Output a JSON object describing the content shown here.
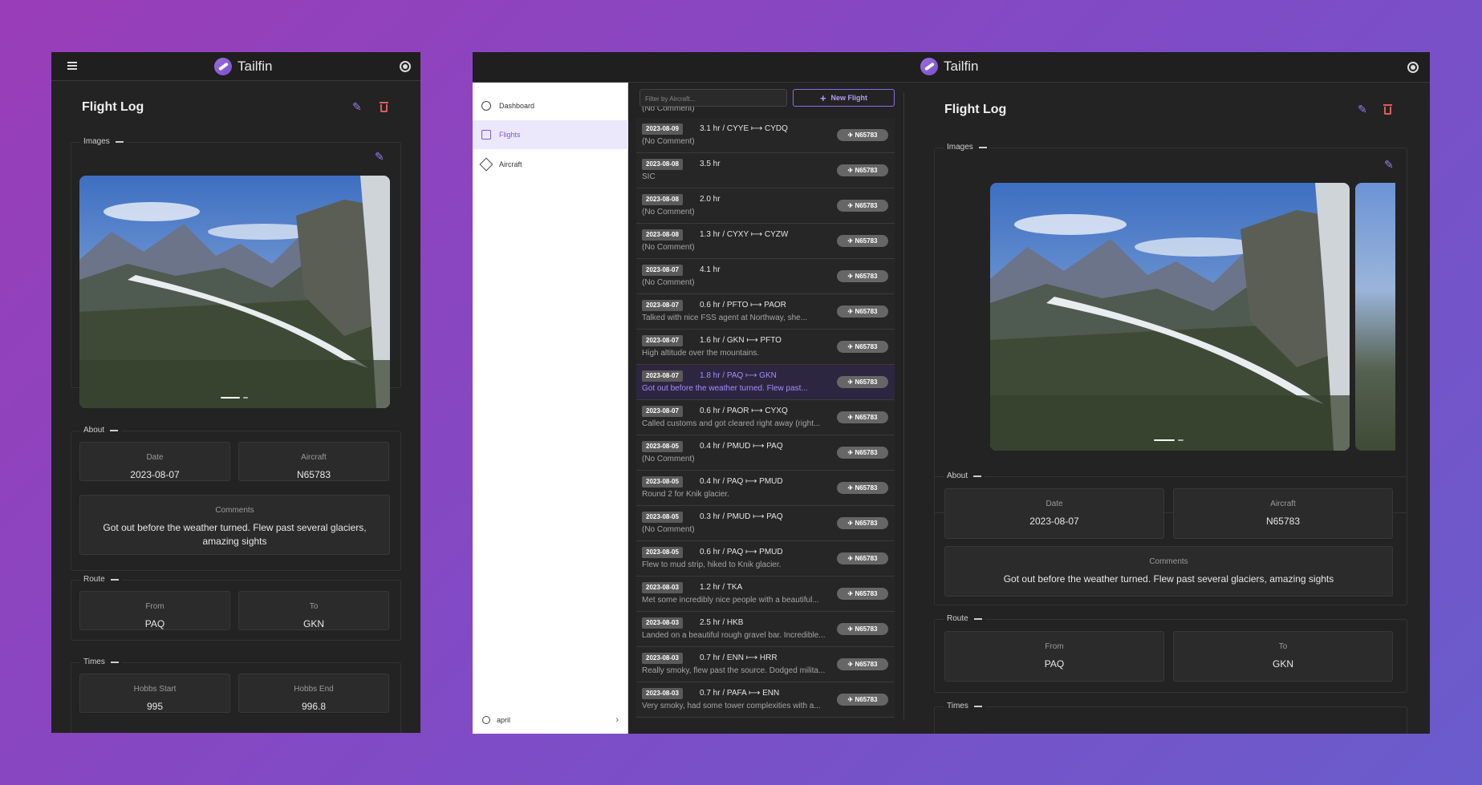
{
  "app": {
    "name": "Tailfin"
  },
  "mobile": {
    "page_title": "Flight Log",
    "sections": {
      "images": "Images",
      "about": "About",
      "route": "Route",
      "times": "Times"
    },
    "about": {
      "date_label": "Date",
      "date": "2023-08-07",
      "aircraft_label": "Aircraft",
      "aircraft": "N65783",
      "comments_label": "Comments",
      "comments": "Got out before the weather turned. Flew past several glaciers, amazing sights"
    },
    "route": {
      "from_label": "From",
      "from": "PAQ",
      "to_label": "To",
      "to": "GKN"
    },
    "times": {
      "hobbs_start_label": "Hobbs Start",
      "hobbs_start": "995",
      "hobbs_end_label": "Hobbs End",
      "hobbs_end": "996.8"
    }
  },
  "desktop": {
    "sidebar": {
      "items": [
        {
          "label": "Dashboard"
        },
        {
          "label": "Flights"
        },
        {
          "label": "Aircraft"
        }
      ],
      "user": "april"
    },
    "filter_placeholder": "Filter by Aircraft...",
    "new_flight_label": "New Flight",
    "partial_top_comment": "(No Comment)",
    "flights": [
      {
        "date": "2023-08-09",
        "info": "3.1 hr  /  CYYE ⟼ CYDQ",
        "comment": "(No Comment)",
        "tail": "N65783"
      },
      {
        "date": "2023-08-08",
        "info": "3.5 hr",
        "comment": "SIC",
        "tail": "N65783"
      },
      {
        "date": "2023-08-08",
        "info": "2.0 hr",
        "comment": "(No Comment)",
        "tail": "N65783"
      },
      {
        "date": "2023-08-08",
        "info": "1.3 hr  /  CYXY ⟼ CYZW",
        "comment": "(No Comment)",
        "tail": "N65783"
      },
      {
        "date": "2023-08-07",
        "info": "4.1 hr",
        "comment": "(No Comment)",
        "tail": "N65783"
      },
      {
        "date": "2023-08-07",
        "info": "0.6 hr  /  PFTO ⟼ PAOR",
        "comment": "Talked with nice FSS agent at Northway, she...",
        "tail": "N65783"
      },
      {
        "date": "2023-08-07",
        "info": "1.6 hr  /  GKN ⟼ PFTO",
        "comment": "High altitude over the mountains.",
        "tail": "N65783"
      },
      {
        "date": "2023-08-07",
        "info": "1.8 hr  /  PAQ ⟼ GKN",
        "comment": "Got out before the weather turned. Flew past...",
        "tail": "N65783",
        "active": true
      },
      {
        "date": "2023-08-07",
        "info": "0.6 hr  /  PAOR ⟼ CYXQ",
        "comment": "Called customs and got cleared right away (right...",
        "tail": "N65783"
      },
      {
        "date": "2023-08-05",
        "info": "0.4 hr  /  PMUD ⟼ PAQ",
        "comment": "(No Comment)",
        "tail": "N65783"
      },
      {
        "date": "2023-08-05",
        "info": "0.4 hr  /  PAQ ⟼ PMUD",
        "comment": "Round 2 for Knik glacier.",
        "tail": "N65783"
      },
      {
        "date": "2023-08-05",
        "info": "0.3 hr  /  PMUD ⟼ PAQ",
        "comment": "(No Comment)",
        "tail": "N65783"
      },
      {
        "date": "2023-08-05",
        "info": "0.6 hr  /  PAQ ⟼ PMUD",
        "comment": "Flew to mud strip, hiked to Knik glacier.",
        "tail": "N65783"
      },
      {
        "date": "2023-08-03",
        "info": "1.2 hr  /  TKA",
        "comment": "Met some incredibly nice people with a beautiful...",
        "tail": "N65783"
      },
      {
        "date": "2023-08-03",
        "info": "2.5 hr  /  HKB",
        "comment": "Landed on a beautiful rough gravel bar. Incredible...",
        "tail": "N65783"
      },
      {
        "date": "2023-08-03",
        "info": "0.7 hr  /  ENN ⟼ HRR",
        "comment": "Really smoky, flew past the source. Dodged milita...",
        "tail": "N65783"
      },
      {
        "date": "2023-08-03",
        "info": "0.7 hr  /  PAFA ⟼ ENN",
        "comment": "Very smoky, had some tower complexities with a...",
        "tail": "N65783"
      }
    ],
    "detail": {
      "page_title": "Flight Log",
      "sections": {
        "images": "Images",
        "about": "About",
        "route": "Route",
        "times": "Times"
      },
      "date_label": "Date",
      "date": "2023-08-07",
      "aircraft_label": "Aircraft",
      "aircraft": "N65783",
      "comments_label": "Comments",
      "comments": "Got out before the weather turned. Flew past several glaciers, amazing sights",
      "from_label": "From",
      "from": "PAQ",
      "to_label": "To",
      "to": "GKN"
    }
  },
  "colors": {
    "accent": "#8d6be8",
    "danger": "#e05d5d",
    "dark_bg": "#232323",
    "background_gradient_start": "#9a3db8",
    "background_gradient_end": "#6a5ccc"
  }
}
